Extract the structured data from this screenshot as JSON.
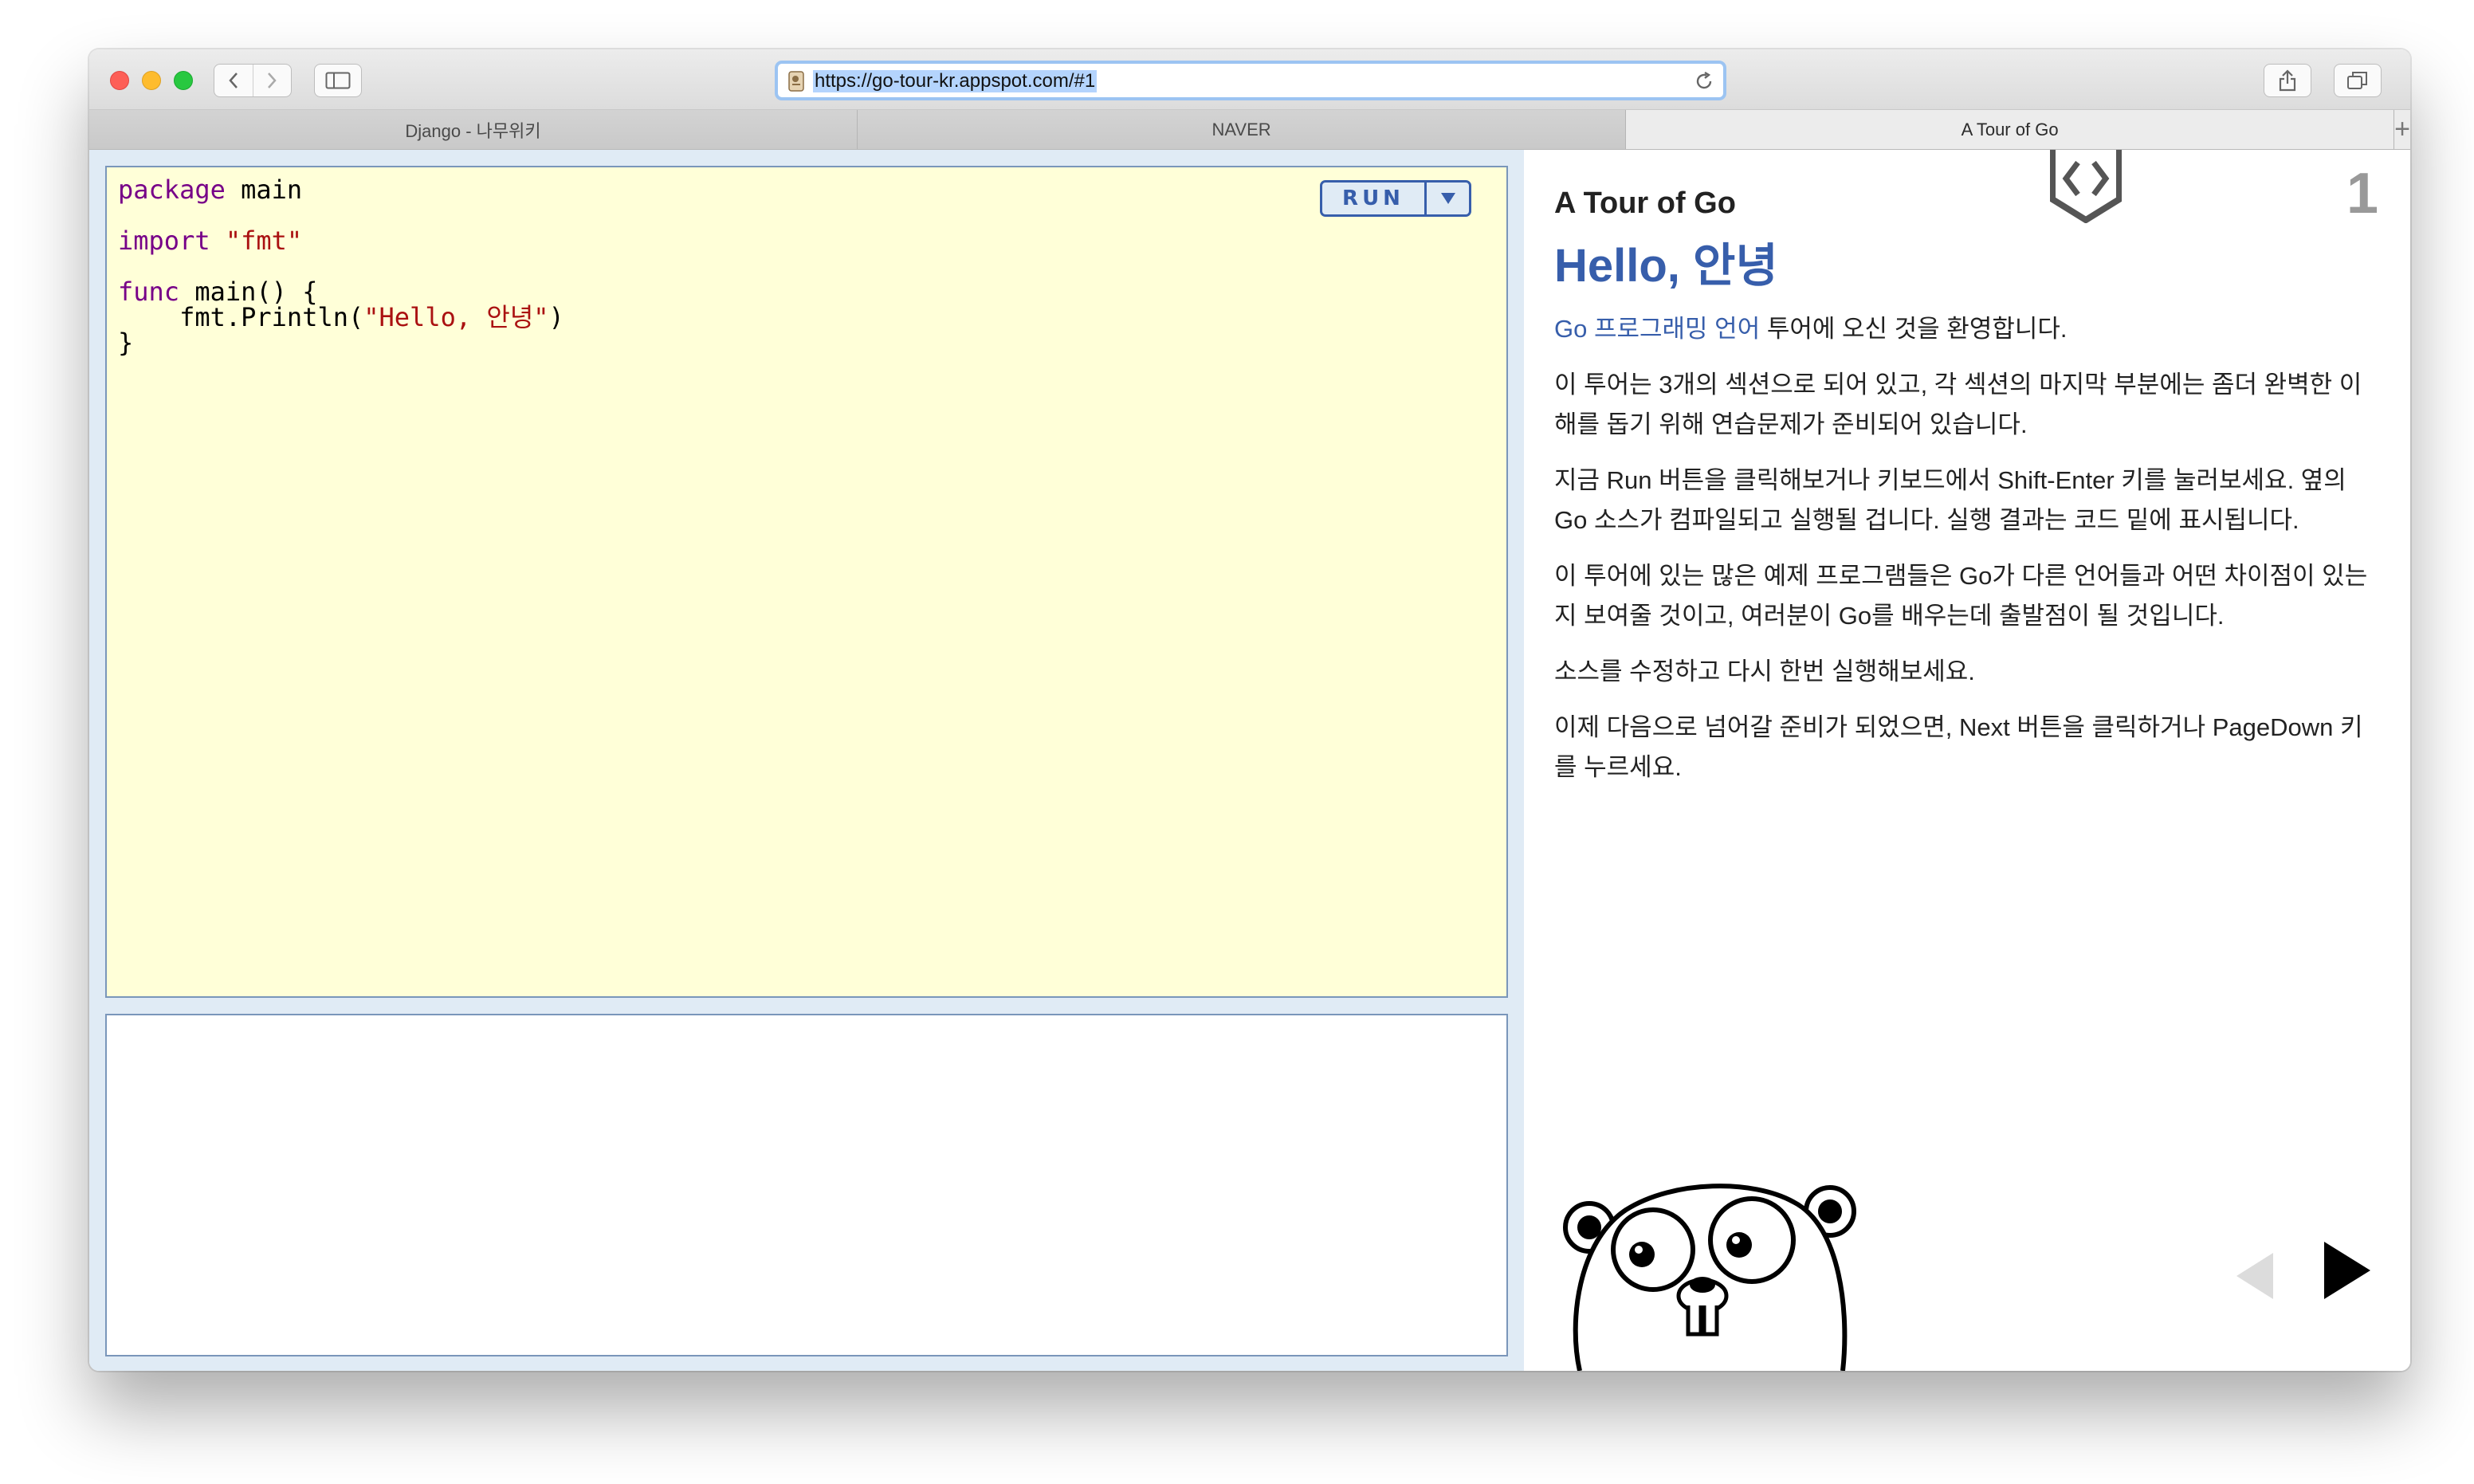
{
  "browser": {
    "url": "https://go-tour-kr.appspot.com/#1",
    "tabs": [
      {
        "label": "Django - 나무위키",
        "active": false
      },
      {
        "label": "NAVER",
        "active": false
      },
      {
        "label": "A Tour of Go",
        "active": true
      }
    ],
    "new_tab_label": "+"
  },
  "editor": {
    "run_label": "RUN",
    "code": {
      "l1_kw": "package",
      "l1_rest": " main",
      "l2_kw": "import",
      "l2_sp": " ",
      "l2_str": "\"fmt\"",
      "l3_kw": "func",
      "l3_rest": " main() {",
      "l4_pre": "    fmt.Println(",
      "l4_str": "\"Hello, 안녕\"",
      "l4_post": ")",
      "l5": "}"
    },
    "output": ""
  },
  "lesson": {
    "module_title": "A Tour of Go",
    "page_number": "1",
    "title": "Hello, 안녕",
    "p1_link": "Go 프로그래밍 언어",
    "p1_rest": " 투어에 오신 것을 환영합니다.",
    "p2": "이 투어는 3개의 섹션으로 되어 있고, 각 섹션의 마지막 부분에는 좀더 완벽한 이해를 돕기 위해 연습문제가 준비되어 있습니다.",
    "p3": "지금 Run 버튼을 클릭해보거나 키보드에서 Shift-Enter 키를 눌러보세요. 옆의 Go 소스가 컴파일되고 실행될 겁니다. 실행 결과는 코드 밑에 표시됩니다.",
    "p4": "이 투어에 있는 많은 예제 프로그램들은 Go가 다른 언어들과 어떤 차이점이 있는지 보여줄 것이고, 여러분이 Go를 배우는데 출발점이 될 것입니다.",
    "p5": "소스를 수정하고 다시 한번 실행해보세요.",
    "p6": "이제 다음으로 넘어갈 준비가 되었으면, Next 버튼을 클릭하거나 PageDown 키를 누르세요."
  },
  "colors": {
    "accent": "#375eab",
    "editor_bg": "#ffffd8",
    "pane_bg": "#e0ebf5",
    "keyword": "#770088",
    "string": "#aa1111"
  },
  "icons": [
    "back-icon",
    "forward-icon",
    "sidebar-icon",
    "page-icon",
    "reload-icon",
    "share-icon",
    "tabs-overview-icon",
    "dropdown-icon",
    "go-logo-icon",
    "prev-icon",
    "next-icon"
  ]
}
